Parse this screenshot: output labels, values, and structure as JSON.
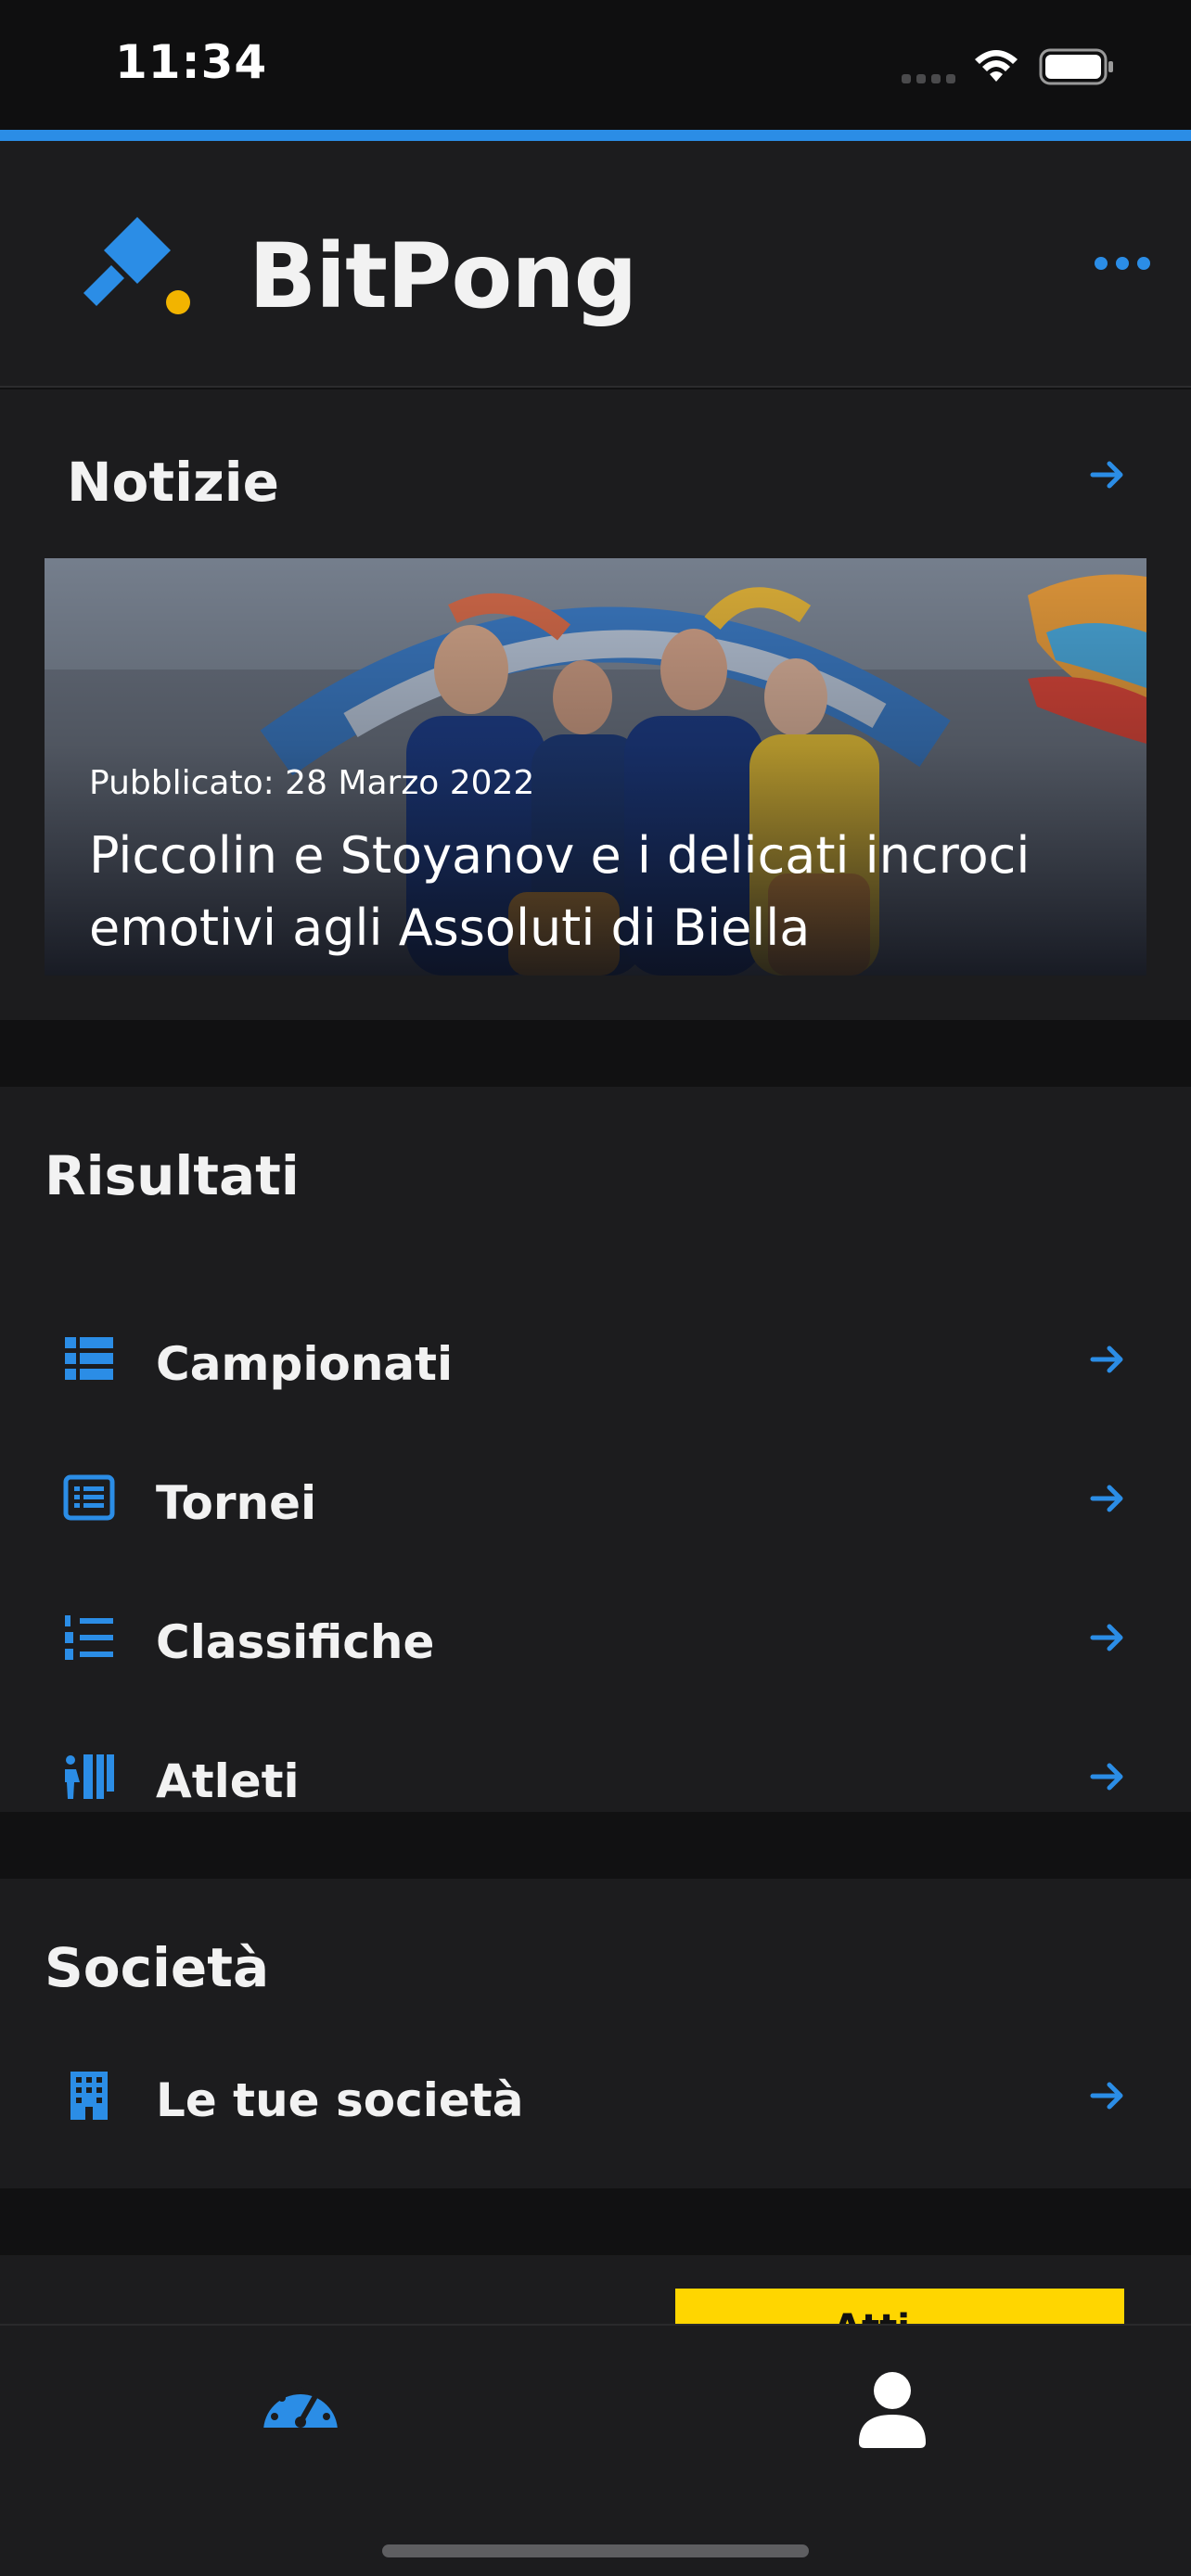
{
  "status_bar": {
    "time": "11:34"
  },
  "colors": {
    "accent": "#2b8de6",
    "logo_dot": "#f2b400",
    "background": "#1c1c1e",
    "ad": "#ffd600"
  },
  "header": {
    "title": "BitPong",
    "more_icon": "more-horizontal-icon"
  },
  "news": {
    "title": "Notizie",
    "article": {
      "date": "Pubblicato: 28 Marzo 2022",
      "headline": "Piccolin e Stoyanov e i delicati incroci emotivi agli Assoluti di Biella"
    }
  },
  "results": {
    "title": "Risultati",
    "items": [
      {
        "label": "Campionati",
        "icon": "table-list-icon"
      },
      {
        "label": "Tornei",
        "icon": "list-alt-icon"
      },
      {
        "label": "Classifiche",
        "icon": "numbered-list-icon"
      },
      {
        "label": "Atleti",
        "icon": "athletes-icon"
      }
    ]
  },
  "societa": {
    "title": "Società",
    "items": [
      {
        "label": "Le tue società",
        "icon": "building-icon"
      }
    ]
  },
  "ad": {
    "text": "Atti"
  },
  "tabs": [
    {
      "name": "dashboard",
      "icon": "dashboard-icon",
      "active": true
    },
    {
      "name": "profile",
      "icon": "user-icon",
      "active": false
    }
  ]
}
